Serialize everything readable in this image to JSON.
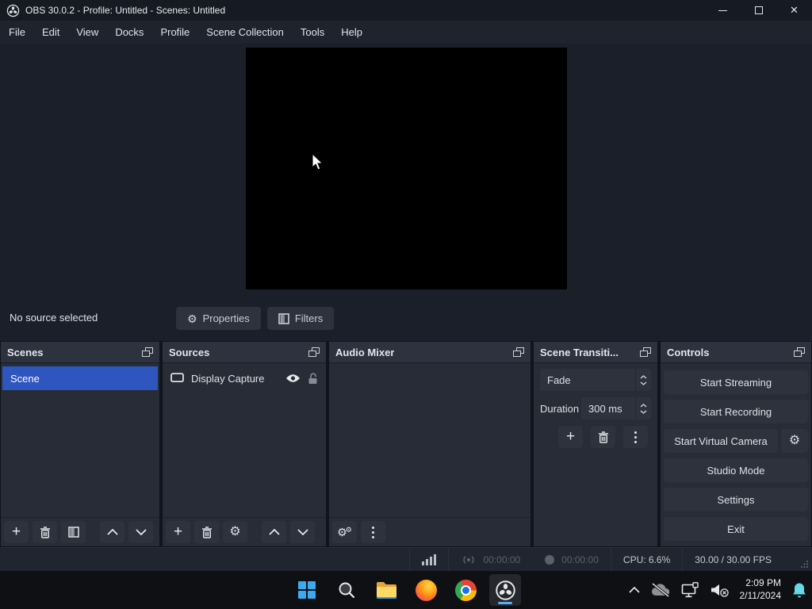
{
  "window": {
    "title": "OBS 30.0.2 - Profile: Untitled - Scenes: Untitled"
  },
  "menu": {
    "items": [
      "File",
      "Edit",
      "View",
      "Docks",
      "Profile",
      "Scene Collection",
      "Tools",
      "Help"
    ]
  },
  "source_row": {
    "status": "No source selected",
    "properties_label": "Properties",
    "filters_label": "Filters"
  },
  "scenes": {
    "title": "Scenes",
    "items": [
      {
        "label": "Scene",
        "selected": true
      }
    ]
  },
  "sources": {
    "title": "Sources",
    "items": [
      {
        "label": "Display Capture"
      }
    ]
  },
  "audio_mixer": {
    "title": "Audio Mixer"
  },
  "transitions": {
    "title": "Scene Transiti...",
    "transition_value": "Fade",
    "duration_label": "Duration",
    "duration_value": "300 ms"
  },
  "controls": {
    "title": "Controls",
    "start_streaming": "Start Streaming",
    "start_recording": "Start Recording",
    "virtual_camera": "Start Virtual Camera",
    "studio_mode": "Studio Mode",
    "settings": "Settings",
    "exit": "Exit"
  },
  "status_bar": {
    "stream_time": "00:00:00",
    "record_time": "00:00:00",
    "cpu": "CPU: 6.6%",
    "fps": "30.00 / 30.00 FPS"
  },
  "taskbar": {
    "clock_time": "2:09 PM",
    "clock_date": "2/11/2024"
  },
  "icons": {
    "gear": "⚙",
    "plus": "+",
    "minimize_note": "minus-line",
    "close": "✕"
  },
  "colors": {
    "selection_blue": "#2f55bf",
    "taskbar_accent": "#53b1f2",
    "bell": "#67d8e8"
  }
}
